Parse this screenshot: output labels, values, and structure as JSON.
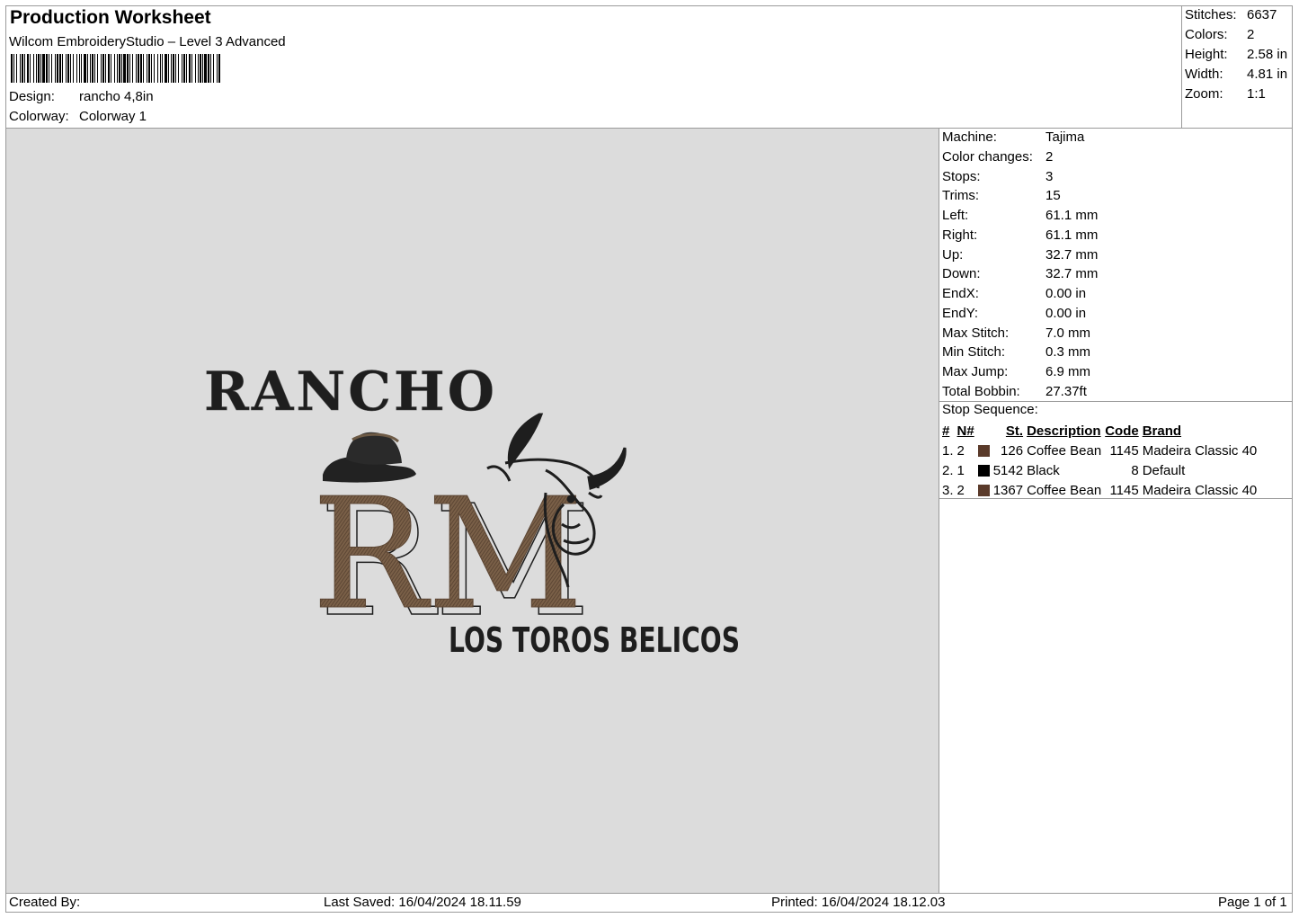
{
  "header": {
    "title": "Production Worksheet",
    "software": "Wilcom EmbroideryStudio – Level 3 Advanced",
    "design_label": "Design:",
    "design_value": "rancho 4,8in",
    "colorway_label": "Colorway:",
    "colorway_value": "Colorway 1"
  },
  "stats": [
    {
      "label": "Stitches:",
      "value": "6637"
    },
    {
      "label": "Colors:",
      "value": "2"
    },
    {
      "label": "Height:",
      "value": "2.58 in"
    },
    {
      "label": "Width:",
      "value": "4.81 in"
    },
    {
      "label": "Zoom:",
      "value": "1:1"
    }
  ],
  "machine": [
    {
      "label": "Machine:",
      "value": "Tajima"
    },
    {
      "label": "Color changes:",
      "value": "2"
    },
    {
      "label": "Stops:",
      "value": "3"
    },
    {
      "label": "Trims:",
      "value": "15"
    },
    {
      "label": "Left:",
      "value": "61.1 mm"
    },
    {
      "label": "Right:",
      "value": "61.1 mm"
    },
    {
      "label": "Up:",
      "value": "32.7 mm"
    },
    {
      "label": "Down:",
      "value": "32.7 mm"
    },
    {
      "label": "EndX:",
      "value": "0.00 in"
    },
    {
      "label": "EndY:",
      "value": "0.00 in"
    },
    {
      "label": "Max Stitch:",
      "value": "7.0 mm"
    },
    {
      "label": "Min Stitch:",
      "value": "0.3 mm"
    },
    {
      "label": "Max Jump:",
      "value": "6.9 mm"
    },
    {
      "label": "Total Bobbin:",
      "value": "27.37ft"
    }
  ],
  "stop_sequence": {
    "title": "Stop Sequence:",
    "headers": [
      "#",
      "N#",
      "St.",
      "Description",
      "Code",
      "Brand"
    ],
    "rows": [
      {
        "num": "1.",
        "n": "2",
        "color": "#5a3a2a",
        "st": "126",
        "desc": "Coffee Bean",
        "code": "1145",
        "brand": "Madeira Classic 40"
      },
      {
        "num": "2.",
        "n": "1",
        "color": "#000000",
        "st": "5142",
        "desc": "Black",
        "code": "8",
        "brand": "Default"
      },
      {
        "num": "3.",
        "n": "2",
        "color": "#5a3a2a",
        "st": "1367",
        "desc": "Coffee Bean",
        "code": "1145",
        "brand": "Madeira Classic 40"
      }
    ]
  },
  "design_art": {
    "top_text": "RANCHO",
    "monogram": "RM",
    "bottom_text": "LOS TOROS BELICOS",
    "thread_brown": "#7a6048",
    "thread_black": "#1e1e1e"
  },
  "footer": {
    "created_by": "Created By:",
    "last_saved": "Last Saved: 16/04/2024 18.11.59",
    "printed": "Printed: 16/04/2024 18.12.03",
    "page": "Page 1 of 1"
  }
}
